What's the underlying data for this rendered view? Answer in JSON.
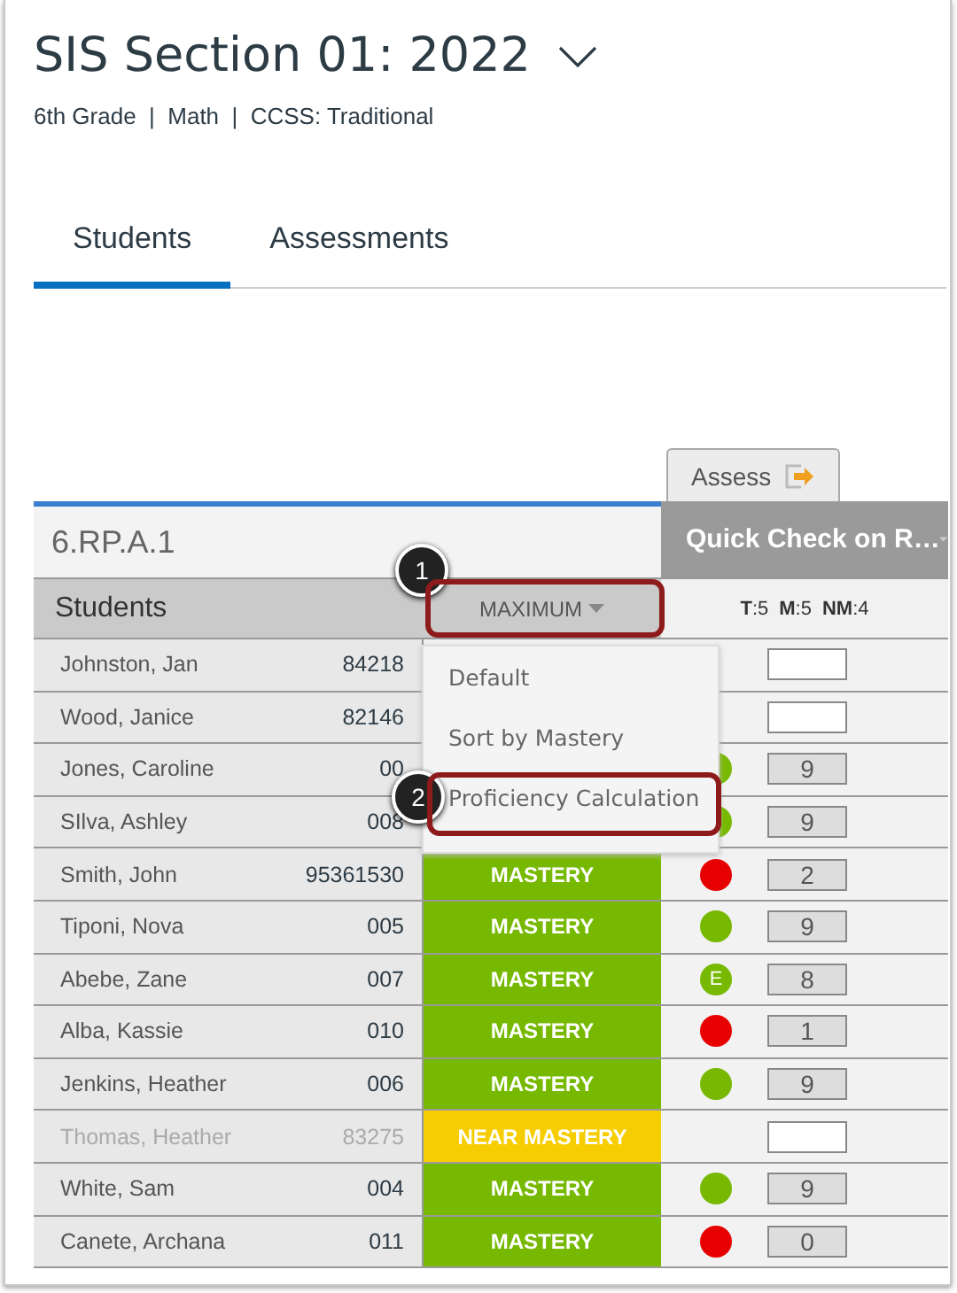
{
  "header": {
    "title": "SIS Section 01: 2022",
    "subtitle": "6th Grade  |  Math  |  CCSS: Traditional"
  },
  "tabs": [
    {
      "label": "Students",
      "selected": true
    },
    {
      "label": "Assessments",
      "selected": false
    }
  ],
  "assess_button": {
    "label": "Assess"
  },
  "table": {
    "outcome": "6.RP.A.1",
    "students_header": "Students",
    "sort_button": {
      "label": "MAXIMUM",
      "callout": "1"
    },
    "assessment": {
      "title": "Quick Check on R…",
      "counts": [
        "**T**:5",
        "**M**:5",
        "**NM**:4"
      ]
    },
    "rows": [
      {
        "name": "Johnston, Jan",
        "id": "84218",
        "inactive": false
      },
      {
        "name": "Wood, Janice",
        "id": "82146",
        "inactive": false
      },
      {
        "name": "Jones, Caroline",
        "id": "00",
        "inactive": false,
        "dot": {
          "color": "#76b900"
        },
        "score": "9"
      },
      {
        "name": "SIlva, Ashley",
        "id": "008",
        "inactive": false,
        "dot": {
          "color": "#76b900"
        },
        "score": "9"
      },
      {
        "name": "Smith, John",
        "id": "95361530",
        "inactive": false,
        "mastery": {
          "label": "MASTERY",
          "kind": "mastery"
        },
        "dot": {
          "color": "#e60000"
        },
        "score": "2"
      },
      {
        "name": "Tiponi, Nova",
        "id": "005",
        "inactive": false,
        "mastery": {
          "label": "MASTERY",
          "kind": "mastery"
        },
        "dot": {
          "color": "#76b900"
        },
        "score": "9"
      },
      {
        "name": "Abebe, Zane",
        "id": "007",
        "inactive": false,
        "mastery": {
          "label": "MASTERY",
          "kind": "mastery"
        },
        "dot": {
          "color": "#76b900",
          "label": "E"
        },
        "score": "8"
      },
      {
        "name": "Alba, Kassie",
        "id": "010",
        "inactive": false,
        "mastery": {
          "label": "MASTERY",
          "kind": "mastery"
        },
        "dot": {
          "color": "#e60000"
        },
        "score": "1"
      },
      {
        "name": "Jenkins, Heather",
        "id": "006",
        "inactive": false,
        "mastery": {
          "label": "MASTERY",
          "kind": "mastery"
        },
        "dot": {
          "color": "#76b900"
        },
        "score": "9"
      },
      {
        "name": "Thomas, Heather",
        "id": "83275",
        "inactive": true,
        "mastery": {
          "label": "NEAR MASTERY",
          "kind": "near"
        }
      },
      {
        "name": "White, Sam",
        "id": "004",
        "inactive": false,
        "mastery": {
          "label": "MASTERY",
          "kind": "mastery"
        },
        "dot": {
          "color": "#76b900"
        },
        "score": "9"
      },
      {
        "name": "Canete, Archana",
        "id": "011",
        "inactive": false,
        "mastery": {
          "label": "MASTERY",
          "kind": "mastery"
        },
        "dot": {
          "color": "#e60000"
        },
        "score": "0"
      }
    ]
  },
  "sort_menu": {
    "items": [
      {
        "label": "Default"
      },
      {
        "label": "Sort by Mastery"
      },
      {
        "label": "Proficiency Calculation",
        "callout": "2"
      }
    ]
  }
}
